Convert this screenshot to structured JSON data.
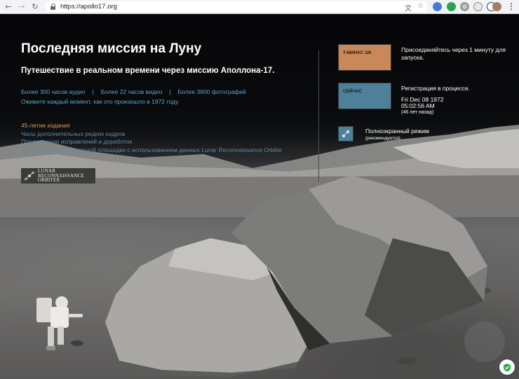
{
  "browser": {
    "url": "https://apollo17.org",
    "back_icon": "←",
    "forward_icon": "→",
    "reload_icon": "↻",
    "star_icon": "☆",
    "translate_icon": "文",
    "menu_icon": "⋮"
  },
  "page": {
    "title": "Последняя миссия на Луну",
    "subtitle": "Путешествие в реальном времени через миссию Аполлона-17.",
    "stats": [
      "Более 300 часов аудио",
      "Более 22 часов видео",
      "Более 3600 фотографий"
    ],
    "stats_separator": "|",
    "relive": "Оживите каждый момент, как это произошло в 1972 году.",
    "links": [
      {
        "label": "45-летие издания",
        "accent": "orange"
      },
      {
        "label": "Часы дополнительных редких кадров",
        "accent": "blue"
      },
      {
        "label": "Продолжение исправлений и доработок",
        "accent": "blue"
      },
      {
        "label": "Реконструкция посадочной площадки с использованием данных Lunar Reconnaissance Orbiter",
        "accent": "blue"
      }
    ],
    "lro_logo": {
      "line1": "LUNAR",
      "line2": "RECONNAISSANCE",
      "line3": "ORBITER"
    }
  },
  "panel": {
    "tminus_label": "T-МИНУС 1М",
    "tminus_desc": "Присоединяйтесь через 1 минуту для запуска.",
    "now_label": "СЕЙЧАС",
    "now_desc": "Регистрация в процессе.",
    "date": "Fri Dec 08 1972",
    "time": "05:02:56 AM",
    "ago": "(46 лет назад)",
    "fullscreen_label": "Полноэкранный режим",
    "fullscreen_rec": "(рекомендуется)"
  },
  "colors": {
    "tminus": "#c8885a",
    "now": "#4f8099",
    "link_blue": "#5aa7c9",
    "link_orange": "#d39a62"
  }
}
